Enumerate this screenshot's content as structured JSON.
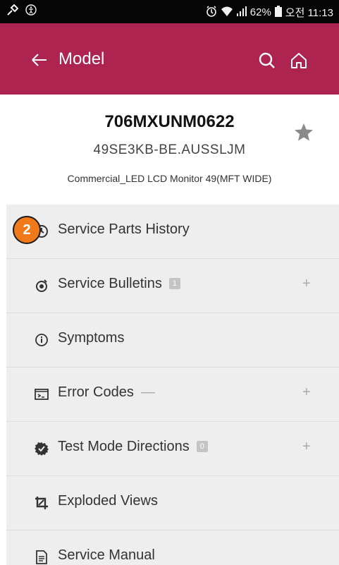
{
  "status_bar": {
    "battery_percent": "62%",
    "clock_label": "오전 11:13"
  },
  "app_bar": {
    "title": "Model"
  },
  "model": {
    "code": "706MXUNM0622",
    "name": "49SE3KB-BE.AUSSLJM",
    "description": "Commercial_LED LCD Monitor 49(MFT WIDE)"
  },
  "menu": {
    "items": [
      {
        "label": "Service Parts History"
      },
      {
        "label": "Service Bulletins",
        "badge": "1"
      },
      {
        "label": "Symptoms"
      },
      {
        "label": "Error Codes"
      },
      {
        "label": "Test Mode Directions",
        "badge": "0"
      },
      {
        "label": "Exploded Views"
      },
      {
        "label": "Service Manual"
      }
    ],
    "plus_glyph": "+",
    "dash_glyph": "—"
  },
  "step_badge": "2",
  "colors": {
    "accent": "#ae2450",
    "status_bar": "#050505",
    "list_bg": "#eeeeee",
    "step_badge": "#f07a1a"
  }
}
